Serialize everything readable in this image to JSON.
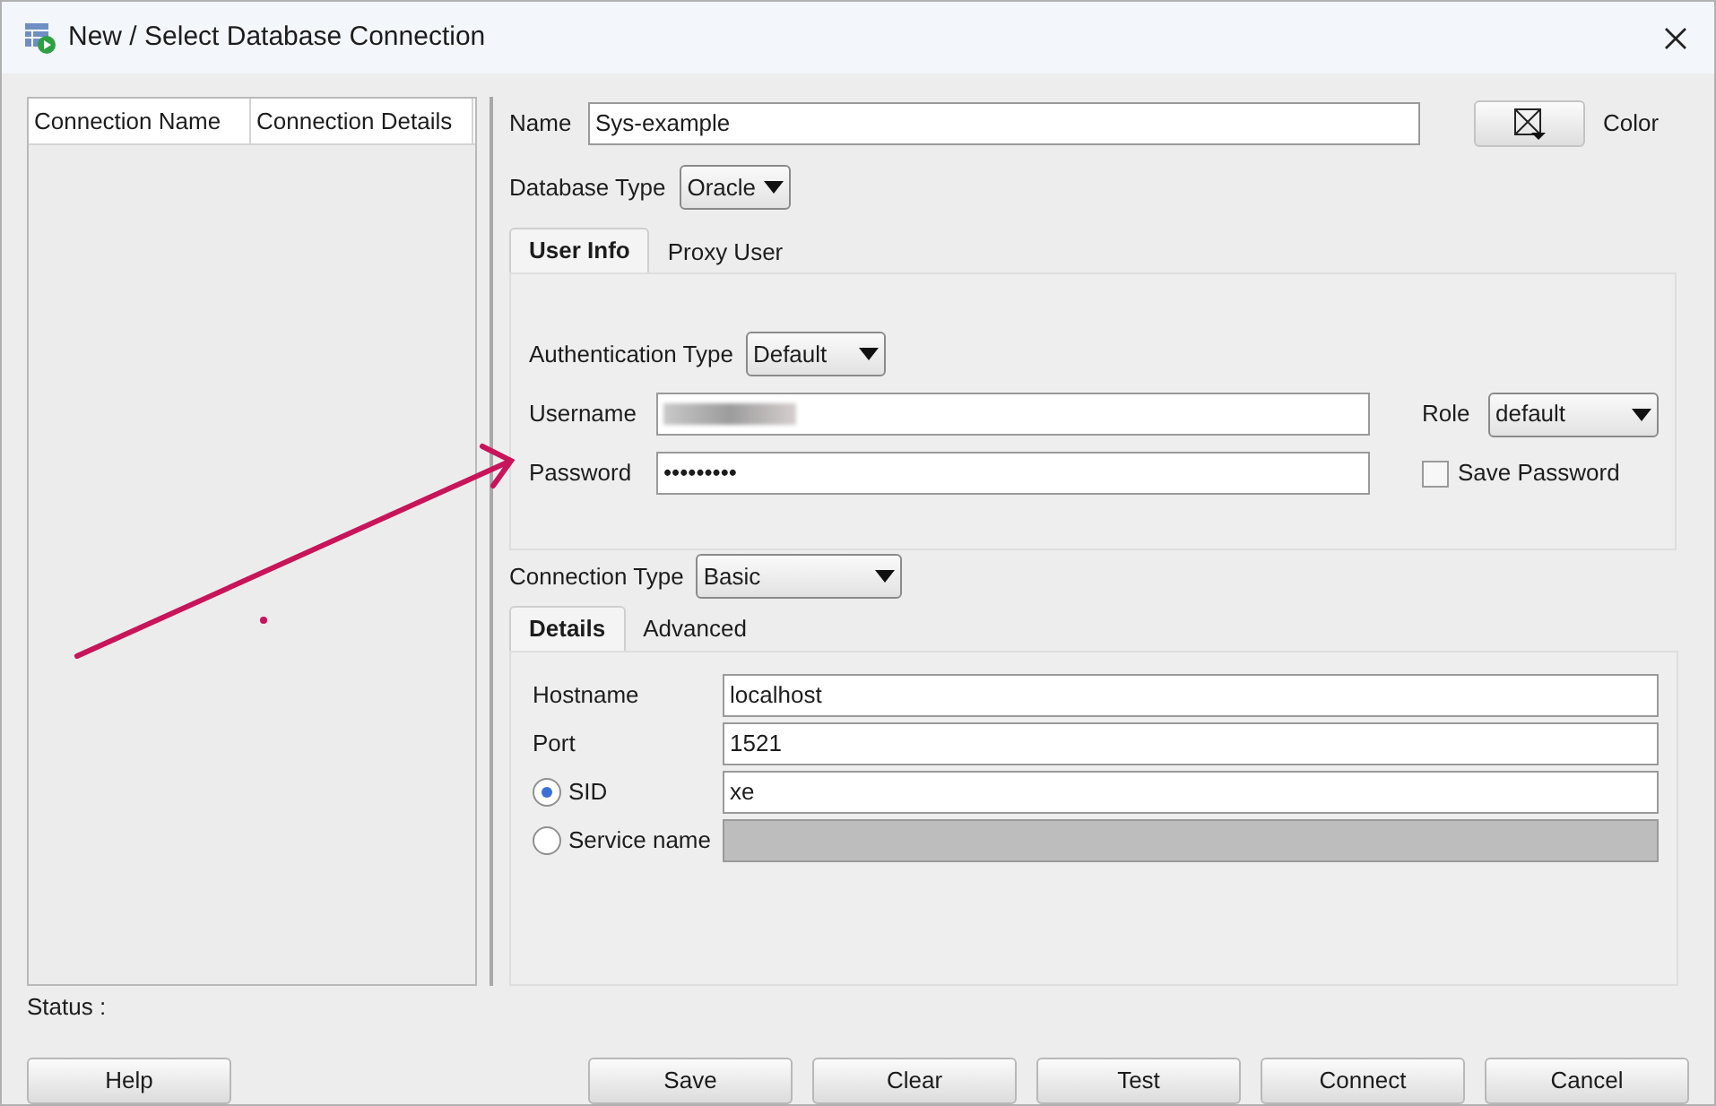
{
  "window": {
    "title": "New / Select Database Connection"
  },
  "connections_table": {
    "columns": [
      "Connection Name",
      "Connection Details"
    ]
  },
  "name": {
    "label": "Name",
    "value": "Sys-example"
  },
  "color": {
    "label": "Color"
  },
  "database_type": {
    "label": "Database Type",
    "value": "Oracle"
  },
  "auth_tabs": [
    {
      "label": "User Info",
      "selected": true
    },
    {
      "label": "Proxy User",
      "selected": false
    }
  ],
  "authentication_type": {
    "label": "Authentication Type",
    "value": "Default"
  },
  "username": {
    "label": "Username"
  },
  "password": {
    "label": "Password",
    "value": "•••••••••"
  },
  "role": {
    "label": "Role",
    "value": "default"
  },
  "save_password": {
    "label": "Save Password",
    "checked": false
  },
  "connection_type": {
    "label": "Connection Type",
    "value": "Basic"
  },
  "detail_tabs": [
    {
      "label": "Details",
      "selected": true
    },
    {
      "label": "Advanced",
      "selected": false
    }
  ],
  "fields": [
    {
      "kind": "text",
      "label": "Hostname",
      "value": "localhost",
      "disabled": false
    },
    {
      "kind": "text",
      "label": "Port",
      "value": "1521",
      "disabled": false
    },
    {
      "kind": "radio",
      "label": "SID",
      "selected": true,
      "value": "xe",
      "disabled": false
    },
    {
      "kind": "radio",
      "label": "Service name",
      "selected": false,
      "disabled": true
    }
  ],
  "status": {
    "label": "Status :"
  },
  "buttons_left": [
    "Help"
  ],
  "buttons_right": [
    "Save",
    "Clear",
    "Test",
    "Connect",
    "Cancel"
  ]
}
